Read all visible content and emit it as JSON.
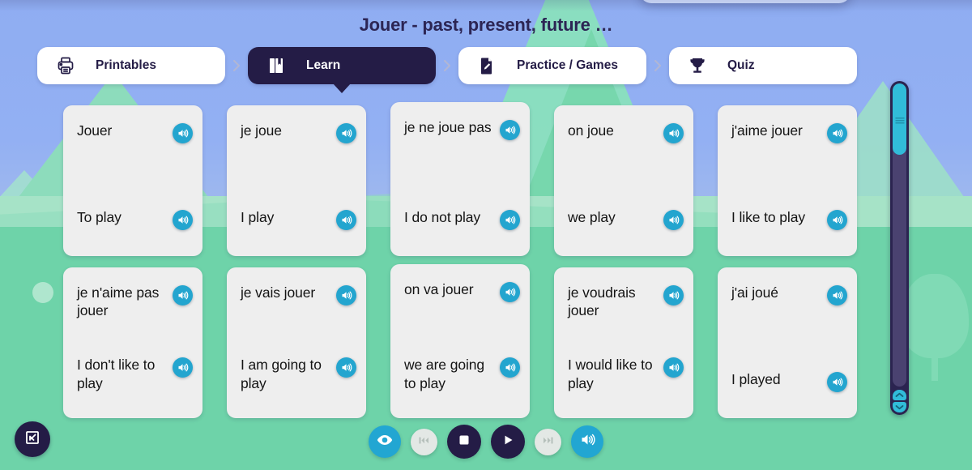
{
  "page": {
    "title": "Jouer - past, present, future …"
  },
  "nav": {
    "tabs": [
      {
        "label": "Printables",
        "icon": "printer-icon",
        "active": false
      },
      {
        "label": "Learn",
        "icon": "book-icon",
        "active": true
      },
      {
        "label": "Practice / Games",
        "icon": "pencil-document-icon",
        "active": false
      },
      {
        "label": "Quiz",
        "icon": "trophy-icon",
        "active": false
      }
    ],
    "separator_icon": "chevron-right-icon"
  },
  "cards": [
    {
      "front": "Jouer",
      "back": "To play"
    },
    {
      "front": "je joue",
      "back": "I play"
    },
    {
      "front": "je ne joue pas",
      "back": "I do not play"
    },
    {
      "front": "on joue",
      "back": "we play"
    },
    {
      "front": "j'aime jouer",
      "back": "I like to play"
    },
    {
      "front": "je n'aime pas jouer",
      "back": "I don't like to play"
    },
    {
      "front": "je vais jouer",
      "back": "I am going to play"
    },
    {
      "front": "on va jouer",
      "back": "we are going to play"
    },
    {
      "front": "je voudrais jouer",
      "back": "I would like to play"
    },
    {
      "front": "j'ai joué",
      "back": "I played"
    }
  ],
  "card_audio_icon": "speaker-icon",
  "scrollbar": {
    "up_icon": "chevron-up-icon",
    "down_icon": "chevron-down-icon",
    "thumb_position": "top"
  },
  "controls": [
    {
      "name": "reveal-button",
      "icon": "eye-icon",
      "style": "cyan"
    },
    {
      "name": "previous-button",
      "icon": "skip-back-icon",
      "style": "ghost"
    },
    {
      "name": "stop-button",
      "icon": "stop-icon",
      "style": "dark"
    },
    {
      "name": "play-button",
      "icon": "play-icon",
      "style": "dark"
    },
    {
      "name": "next-button",
      "icon": "skip-forward-icon",
      "style": "ghost"
    },
    {
      "name": "audio-button",
      "icon": "speaker-icon",
      "style": "cyan"
    }
  ],
  "fullscreen": {
    "icon": "expand-icon"
  },
  "colors": {
    "accent_cyan": "#22a6d2",
    "dark_navy": "#241c46",
    "card_bg": "#eeeeee",
    "sky_blue": "#8fadf2",
    "hill_green": "#6ed3a9"
  }
}
